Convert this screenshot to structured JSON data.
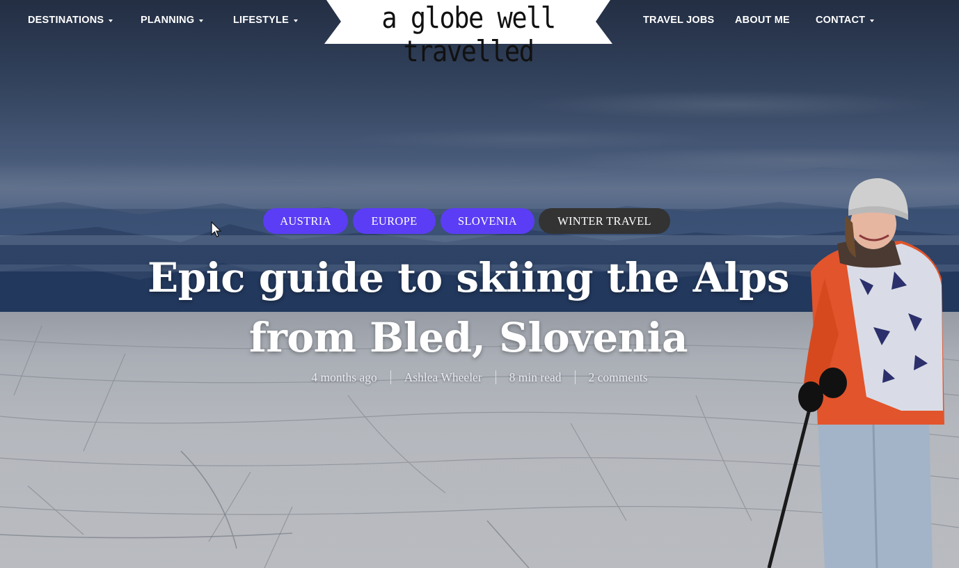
{
  "nav": {
    "left": [
      {
        "label": "DESTINATIONS",
        "has_dropdown": true
      },
      {
        "label": "PLANNING",
        "has_dropdown": true
      },
      {
        "label": "LIFESTYLE",
        "has_dropdown": true
      }
    ],
    "right": [
      {
        "label": "TRAVEL JOBS",
        "has_dropdown": false
      },
      {
        "label": "ABOUT ME",
        "has_dropdown": false
      },
      {
        "label": "CONTACT",
        "has_dropdown": true
      }
    ]
  },
  "logo": {
    "text": "a globe well travelled"
  },
  "post": {
    "categories": [
      {
        "label": "AUSTRIA",
        "color": "#5b3df5"
      },
      {
        "label": "EUROPE",
        "color": "#5b3df5"
      },
      {
        "label": "SLOVENIA",
        "color": "#5b3df5"
      },
      {
        "label": "WINTER TRAVEL",
        "color": "#333333"
      }
    ],
    "title_line1": "Epic guide to skiing the Alps",
    "title_line2": "from Bled, Slovenia",
    "meta": {
      "date": "4 months ago",
      "author": "Ashlea Wheeler",
      "read_time": "8 min read",
      "comments": "2 comments"
    }
  }
}
